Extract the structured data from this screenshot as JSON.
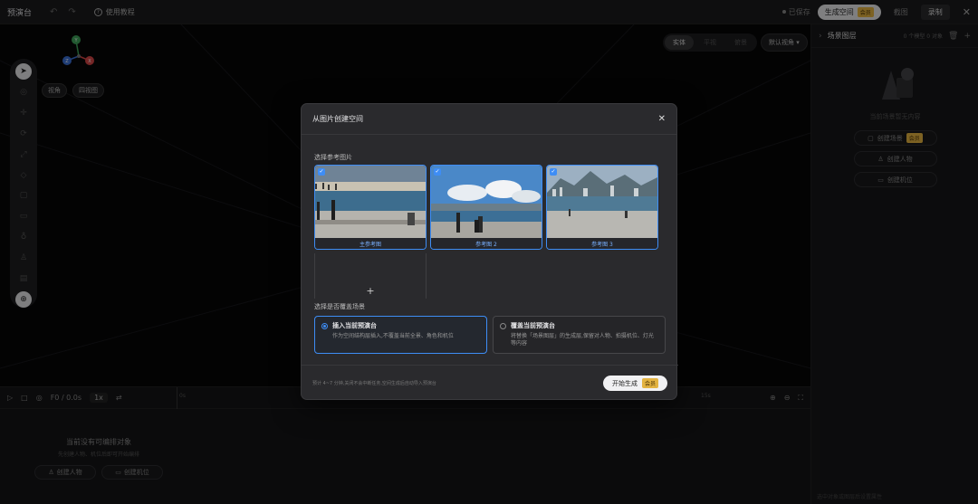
{
  "app": {
    "title": "预演台",
    "tutorial": "使用教程"
  },
  "topbar": {
    "saved": "已保存",
    "generate_space": "生成空间",
    "vip_badge": "会员",
    "link": "截图",
    "record": "录制"
  },
  "viewport": {
    "gizmo_labels": [
      "Y",
      "Z",
      "X"
    ],
    "view_buttons": [
      "视角",
      "四视图"
    ],
    "modes": [
      "实体",
      "平视",
      "俯景"
    ],
    "camera_select": "默认视角"
  },
  "right_panel": {
    "title": "场景图层",
    "meta": "0 个模型 0 对象",
    "hint": "当前场景暂无内容",
    "buttons": [
      "创建场景",
      "创建人物",
      "创建机位"
    ],
    "vip_badge": "会员",
    "footer": "选中对象或图层后设置属性"
  },
  "timeline": {
    "frame": "F0 / 0.0s",
    "speed": "1x",
    "ticks": [
      "0s",
      "5s",
      "10s",
      "15s"
    ],
    "empty_title": "当前没有可编排对象",
    "empty_desc": "先创建人物、机位后即可开始编排",
    "buttons": [
      "创建人物",
      "创建机位"
    ]
  },
  "modal": {
    "title": "从图片创建空间",
    "section_images": "选择参考图片",
    "images": [
      {
        "caption": "主参考图",
        "checked": true
      },
      {
        "caption": "参考图 2",
        "checked": true
      },
      {
        "caption": "参考图 3",
        "checked": true
      }
    ],
    "add": "+",
    "section_scene": "选择是否覆盖场景",
    "options": [
      {
        "title": "插入当前预演台",
        "desc": "作为空间结构层插入,不覆盖当前全景、角色和机位",
        "selected": true
      },
      {
        "title": "覆盖当前预演台",
        "desc": "将替换「场景图层」的生成层,保留对人物、拍摄机位、灯光等内容",
        "selected": false
      }
    ],
    "footer_note": "预计 4~7 分钟,关闭不会中断任务,空间生成后自动导入预演台",
    "start_button": "开始生成",
    "vip_badge": "会员"
  }
}
